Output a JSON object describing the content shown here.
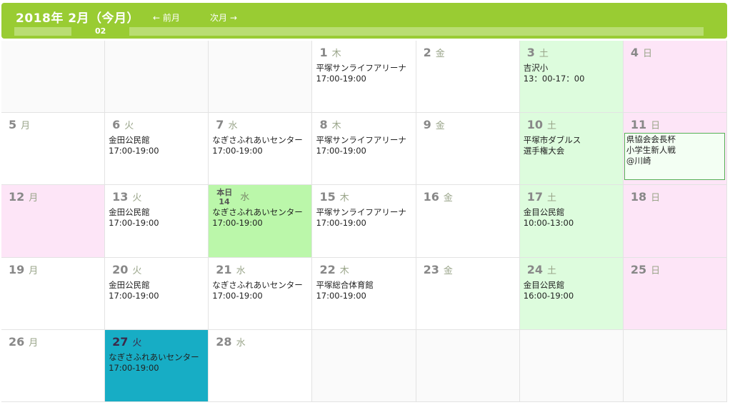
{
  "header": {
    "title": "2018年 2月（今月）",
    "prev_label": "← 前月",
    "next_label": "次月 →",
    "month_bar_label": "02"
  },
  "colors": {
    "header": "#99cc33",
    "saturday": "#ddfcdd",
    "sunday": "#fde5f7",
    "today": "#bbf7aa",
    "selected": "#17adc5"
  },
  "calendar": {
    "today_label": "本日",
    "weeks": [
      [
        {
          "empty": true
        },
        {
          "empty": true
        },
        {
          "empty": true
        },
        {
          "day": "1",
          "wd": "木",
          "events": [
            "平塚サンライフアリーナ",
            "17:00-19:00"
          ]
        },
        {
          "day": "2",
          "wd": "金",
          "events": []
        },
        {
          "day": "3",
          "wd": "土",
          "type": "sat",
          "events": [
            "吉沢小",
            "13：00-17：00"
          ]
        },
        {
          "day": "4",
          "wd": "日",
          "type": "sun",
          "events": []
        }
      ],
      [
        {
          "day": "5",
          "wd": "月",
          "events": []
        },
        {
          "day": "6",
          "wd": "火",
          "events": [
            "金田公民館",
            "17:00-19:00"
          ]
        },
        {
          "day": "7",
          "wd": "水",
          "events": [
            "なぎさふれあいセンター",
            "17:00-19:00"
          ]
        },
        {
          "day": "8",
          "wd": "木",
          "events": [
            "平塚サンライフアリーナ",
            "17:00-19:00"
          ]
        },
        {
          "day": "9",
          "wd": "金",
          "events": []
        },
        {
          "day": "10",
          "wd": "土",
          "type": "sat",
          "events": [
            "平塚市ダブルス",
            "選手権大会"
          ]
        },
        {
          "day": "11",
          "wd": "日",
          "type": "sun",
          "boxed": true,
          "events": [
            "県協会会長杯",
            "小学生新人戦",
            "@川崎"
          ]
        }
      ],
      [
        {
          "day": "12",
          "wd": "月",
          "type": "sun",
          "events": []
        },
        {
          "day": "13",
          "wd": "火",
          "events": [
            "金田公民館",
            "17:00-19:00"
          ]
        },
        {
          "day": "14",
          "wd": "水",
          "type": "today",
          "events": [
            "なぎさふれあいセンター",
            "17:00-19:00"
          ]
        },
        {
          "day": "15",
          "wd": "木",
          "events": [
            "平塚サンライフアリーナ",
            "17:00-19:00"
          ]
        },
        {
          "day": "16",
          "wd": "金",
          "events": []
        },
        {
          "day": "17",
          "wd": "土",
          "type": "sat",
          "events": [
            "金目公民館",
            "10:00-13:00"
          ]
        },
        {
          "day": "18",
          "wd": "日",
          "type": "sun",
          "events": []
        }
      ],
      [
        {
          "day": "19",
          "wd": "月",
          "events": []
        },
        {
          "day": "20",
          "wd": "火",
          "events": [
            "金田公民館",
            "17:00-19:00"
          ]
        },
        {
          "day": "21",
          "wd": "水",
          "events": [
            "なぎさふれあいセンター",
            "17:00-19:00"
          ]
        },
        {
          "day": "22",
          "wd": "木",
          "events": [
            "平塚総合体育館",
            "17:00-19:00"
          ]
        },
        {
          "day": "23",
          "wd": "金",
          "events": []
        },
        {
          "day": "24",
          "wd": "土",
          "type": "sat",
          "events": [
            "金目公民館",
            "16:00-19:00"
          ]
        },
        {
          "day": "25",
          "wd": "日",
          "type": "sun",
          "events": []
        }
      ],
      [
        {
          "day": "26",
          "wd": "月",
          "events": []
        },
        {
          "day": "27",
          "wd": "火",
          "type": "selected",
          "events": [
            "なぎさふれあいセンター",
            "17:00-19:00"
          ]
        },
        {
          "day": "28",
          "wd": "水",
          "events": []
        },
        {
          "empty": true
        },
        {
          "empty": true
        },
        {
          "empty": true
        },
        {
          "empty": true
        }
      ]
    ]
  }
}
